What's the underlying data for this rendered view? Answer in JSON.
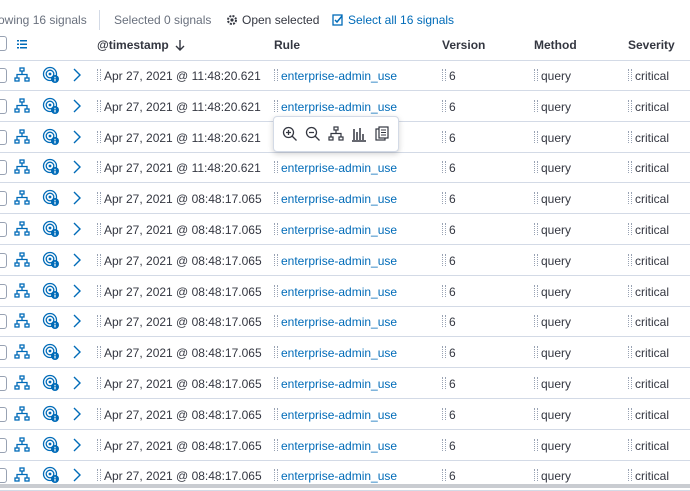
{
  "toolbar": {
    "showing": "owing 16 signals",
    "selected": "Selected 0 signals",
    "open_selected": "Open selected",
    "select_all": "Select all 16 signals"
  },
  "columns": {
    "timestamp": "@timestamp",
    "rule": "Rule",
    "version": "Version",
    "method": "Method",
    "severity": "Severity"
  },
  "rows": [
    {
      "timestamp": "Apr 27, 2021 @ 11:48:20.621",
      "rule": "enterprise-admin_use",
      "version": "6",
      "method": "query",
      "severity": "critical"
    },
    {
      "timestamp": "Apr 27, 2021 @ 11:48:20.621",
      "rule": "enterprise-admin_use",
      "version": "6",
      "method": "query",
      "severity": "critical"
    },
    {
      "timestamp": "Apr 27, 2021 @ 11:48:20.621",
      "rule": "",
      "version": "6",
      "method": "query",
      "severity": "critical"
    },
    {
      "timestamp": "Apr 27, 2021 @ 11:48:20.621",
      "rule": "enterprise-admin_use",
      "version": "6",
      "method": "query",
      "severity": "critical"
    },
    {
      "timestamp": "Apr 27, 2021 @ 08:48:17.065",
      "rule": "enterprise-admin_use",
      "version": "6",
      "method": "query",
      "severity": "critical"
    },
    {
      "timestamp": "Apr 27, 2021 @ 08:48:17.065",
      "rule": "enterprise-admin_use",
      "version": "6",
      "method": "query",
      "severity": "critical"
    },
    {
      "timestamp": "Apr 27, 2021 @ 08:48:17.065",
      "rule": "enterprise-admin_use",
      "version": "6",
      "method": "query",
      "severity": "critical"
    },
    {
      "timestamp": "Apr 27, 2021 @ 08:48:17.065",
      "rule": "enterprise-admin_use",
      "version": "6",
      "method": "query",
      "severity": "critical"
    },
    {
      "timestamp": "Apr 27, 2021 @ 08:48:17.065",
      "rule": "enterprise-admin_use",
      "version": "6",
      "method": "query",
      "severity": "critical"
    },
    {
      "timestamp": "Apr 27, 2021 @ 08:48:17.065",
      "rule": "enterprise-admin_use",
      "version": "6",
      "method": "query",
      "severity": "critical"
    },
    {
      "timestamp": "Apr 27, 2021 @ 08:48:17.065",
      "rule": "enterprise-admin_use",
      "version": "6",
      "method": "query",
      "severity": "critical"
    },
    {
      "timestamp": "Apr 27, 2021 @ 08:48:17.065",
      "rule": "enterprise-admin_use",
      "version": "6",
      "method": "query",
      "severity": "critical"
    },
    {
      "timestamp": "Apr 27, 2021 @ 08:48:17.065",
      "rule": "enterprise-admin_use",
      "version": "6",
      "method": "query",
      "severity": "critical"
    },
    {
      "timestamp": "Apr 27, 2021 @ 08:48:17.065",
      "rule": "enterprise-admin_use",
      "version": "6",
      "method": "query",
      "severity": "critical"
    }
  ],
  "popover_actions": [
    "zoom-in-icon",
    "zoom-out-icon",
    "hierarchy-icon",
    "chart-icon",
    "copy-clipboard-icon"
  ],
  "colors": {
    "link": "#006bb8",
    "text": "#343741",
    "border": "#d3dae6",
    "icon_blue": "#006bb8"
  }
}
